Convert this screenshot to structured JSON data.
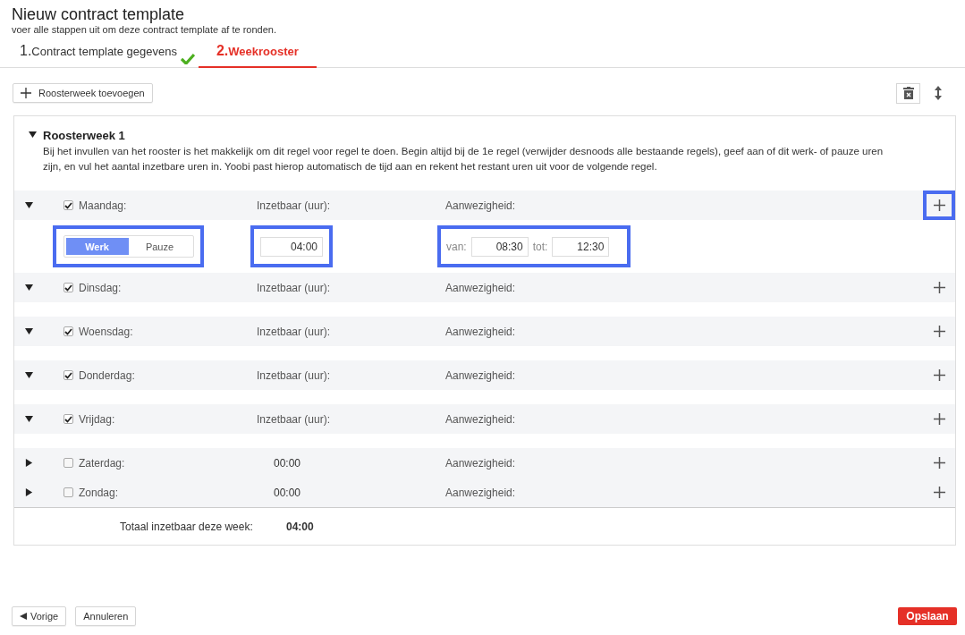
{
  "header": {
    "title": "Nieuw contract template",
    "subtitle": "voer alle stappen uit om deze contract template af te ronden."
  },
  "steps": [
    {
      "number": "1.",
      "label": "Contract template gegevens",
      "selected": false,
      "completed": true
    },
    {
      "number": "2.",
      "label": "Weekrooster",
      "selected": true,
      "completed": false
    }
  ],
  "toolbar": {
    "add_button": "Roosterweek toevoegen"
  },
  "week": {
    "title": "Roosterweek 1",
    "expanded": true,
    "description": "Bij het invullen van het rooster is het makkelijk om dit regel voor regel te doen. Begin altijd bij de 1e regel (verwijder desnoods alle bestaande regels), geef aan of dit werk- of pauze uren zijn, en vul het aantal inzetbare uren in. Yoobi past hierop automatisch de tijd aan en rekent het restant uren uit voor de volgende regel.",
    "days": [
      {
        "label": "Maandag:",
        "checked": true,
        "expanded": true,
        "hours_label": "Inzetbaar (uur):",
        "presence_label": "Aanwezigheid:",
        "add_highlighted": true,
        "entries": [
          {
            "types": [
              {
                "label": "Werk",
                "selected": true
              },
              {
                "label": "Pauze",
                "selected": false
              }
            ],
            "hours": "04:00",
            "from_label": "van:",
            "from": "08:30",
            "to_label": "tot:",
            "to": "12:30",
            "highlighted": true
          }
        ]
      },
      {
        "label": "Dinsdag:",
        "checked": true,
        "expanded": true,
        "hours_label": "Inzetbaar (uur):",
        "presence_label": "Aanwezigheid:",
        "add_highlighted": false
      },
      {
        "label": "Woensdag:",
        "checked": true,
        "expanded": true,
        "hours_label": "Inzetbaar (uur):",
        "presence_label": "Aanwezigheid:",
        "add_highlighted": false
      },
      {
        "label": "Donderdag:",
        "checked": true,
        "expanded": true,
        "hours_label": "Inzetbaar (uur):",
        "presence_label": "Aanwezigheid:",
        "add_highlighted": false
      },
      {
        "label": "Vrijdag:",
        "checked": true,
        "expanded": true,
        "hours_label": "Inzetbaar (uur):",
        "presence_label": "Aanwezigheid:",
        "add_highlighted": false
      },
      {
        "label": "Zaterdag:",
        "checked": false,
        "expanded": false,
        "hours_total": "00:00",
        "presence_label": "Aanwezigheid:",
        "add_highlighted": false
      },
      {
        "label": "Zondag:",
        "checked": false,
        "expanded": false,
        "hours_total": "00:00",
        "presence_label": "Aanwezigheid:",
        "add_highlighted": false
      }
    ],
    "total_label": "Totaal inzetbaar deze week:",
    "total_value": "04:00"
  },
  "footer": {
    "back_button": "Vorige",
    "cancel_button": "Annuleren",
    "save_button": "Opslaan"
  }
}
